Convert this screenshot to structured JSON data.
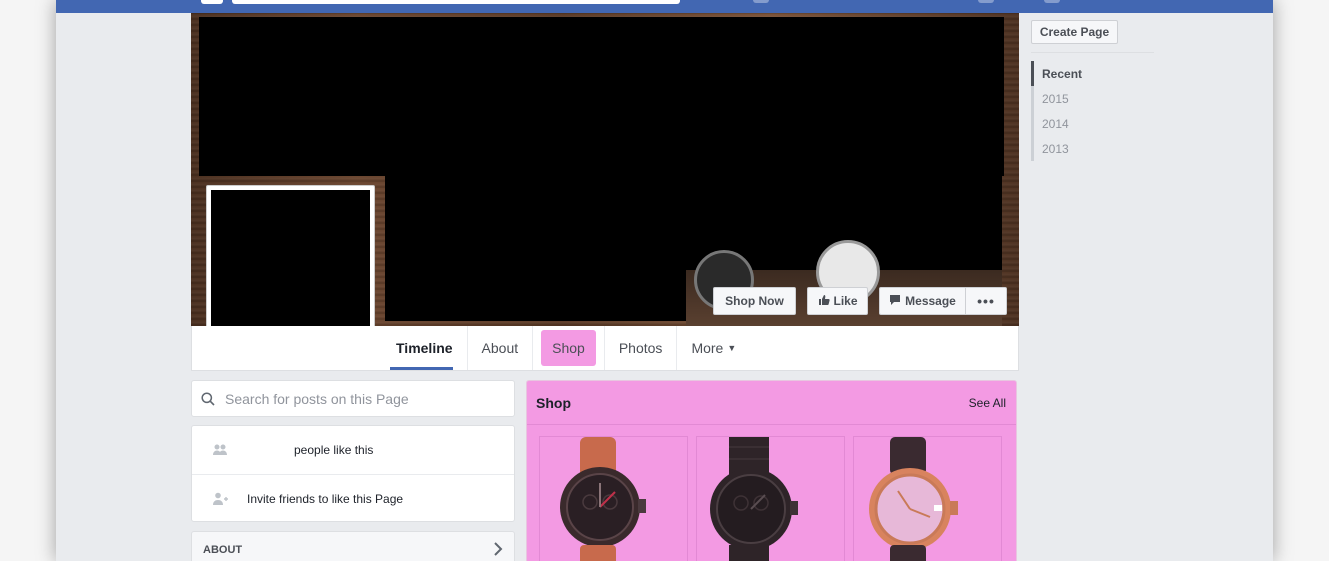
{
  "cover": {
    "actions": {
      "shop_now": "Shop Now",
      "like": "Like",
      "message": "Message",
      "more": "•••"
    }
  },
  "tabs": [
    {
      "label": "Timeline",
      "active": true
    },
    {
      "label": "About"
    },
    {
      "label": "Shop",
      "highlight": true
    },
    {
      "label": "Photos"
    },
    {
      "label": "More"
    }
  ],
  "right_column": {
    "create_page": "Create Page",
    "years": [
      "Recent",
      "2015",
      "2014",
      "2013"
    ]
  },
  "search": {
    "placeholder": "Search for posts on this Page"
  },
  "likes": {
    "people_like": "people like this",
    "invite": "Invite friends to like this Page"
  },
  "about": {
    "label": "ABOUT"
  },
  "shop": {
    "title": "Shop",
    "see_all": "See All",
    "products": [
      {
        "icon": "watch-tan-strap"
      },
      {
        "icon": "watch-black-steel"
      },
      {
        "icon": "watch-rose-gold"
      }
    ]
  },
  "colors": {
    "brand_blue": "#4267b2",
    "shop_highlight": "#f39ae3",
    "page_bg": "#e9ebee"
  }
}
